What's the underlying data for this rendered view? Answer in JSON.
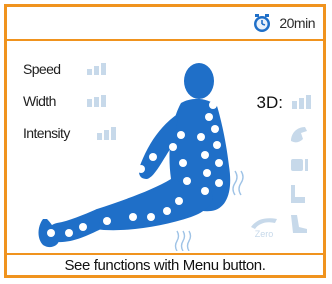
{
  "header": {
    "timer_icon": "clock-icon",
    "timer_text": "20min"
  },
  "params": {
    "speed_label": "Speed",
    "width_label": "Width",
    "intensity_label": "Intensity"
  },
  "mode": {
    "label": "3D:",
    "icons": [
      "kneading-icon",
      "tapping-icon",
      "seat-icon",
      "stretch-icon",
      "zero-gravity-icon",
      "leg-icon"
    ],
    "zero_label": "Zero"
  },
  "footer": {
    "hint": "See functions with Menu button."
  },
  "colors": {
    "frame": "#f0931e",
    "body_blue": "#1f6fc8",
    "inactive": "#c7d9ea"
  }
}
